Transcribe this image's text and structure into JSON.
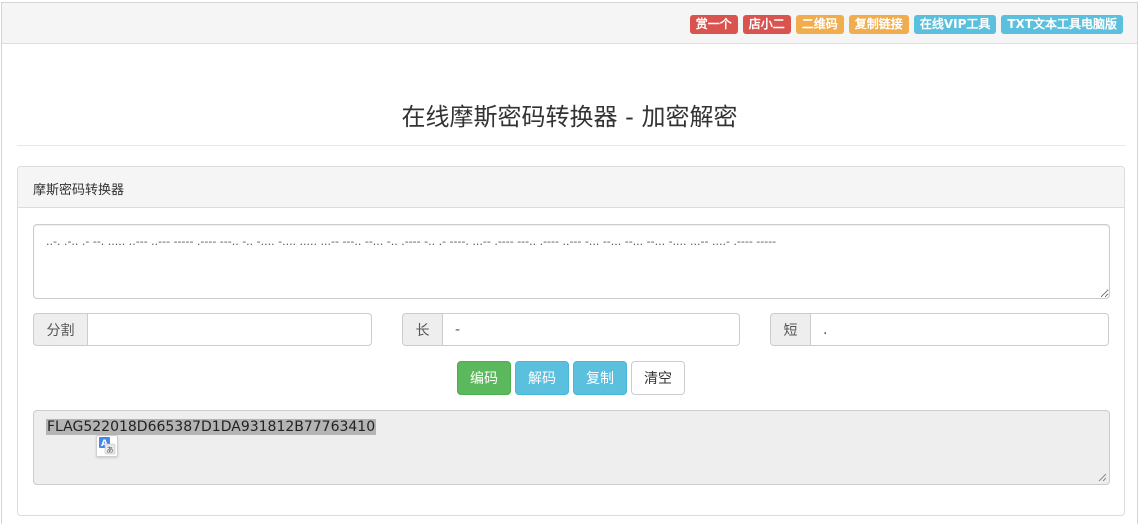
{
  "topbar": {
    "badges": [
      {
        "label": "赏一个",
        "color": "#d9534f"
      },
      {
        "label": "店小二",
        "color": "#d9534f"
      },
      {
        "label": "二维码",
        "color": "#f0ad4e"
      },
      {
        "label": "复制链接",
        "color": "#f0ad4e"
      },
      {
        "label": "在线VIP工具",
        "color": "#5bc0de"
      },
      {
        "label": "TXT文本工具电脑版",
        "color": "#5bc0de"
      }
    ]
  },
  "page": {
    "title": "在线摩斯密码转换器 - 加密解密"
  },
  "panel": {
    "heading": "摩斯密码转换器",
    "morse_text": "..-. .-.. .- --. ..... ..--- ..--- ----- .---- ---.. -.. -.... -.... ..... ...-- ---.. --... -.. .---- -.. .- ----. ...-- .---- ---.. .---- ..--- -... --... --... --... -.... ...-- ....- .---- -----",
    "split_label": "分割",
    "split_value": "",
    "long_label": "长",
    "long_value": "-",
    "short_label": "短",
    "short_value": ".",
    "buttons": {
      "encode": "编码",
      "decode": "解码",
      "copy": "复制",
      "clear": "清空"
    },
    "output_text": "FLAG522018D665387D1DA931812B77763410"
  },
  "icons": {
    "translate": "translate-icon",
    "resize": "resize-grip-icon"
  },
  "colors": {
    "success": "#5cb85c",
    "info": "#5bc0de",
    "danger": "#d9534f",
    "warning": "#f0ad4e"
  }
}
